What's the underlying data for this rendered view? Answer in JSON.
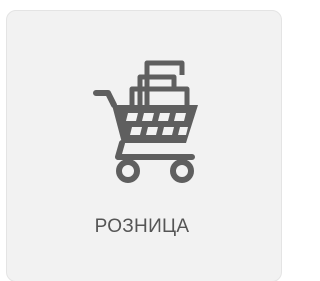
{
  "tile": {
    "label": "РОЗНИЦА",
    "icon": "shopping-cart-icon"
  },
  "colors": {
    "tile_background": "#f2f2f2",
    "icon": "#5f5f5f",
    "text": "#555555"
  }
}
